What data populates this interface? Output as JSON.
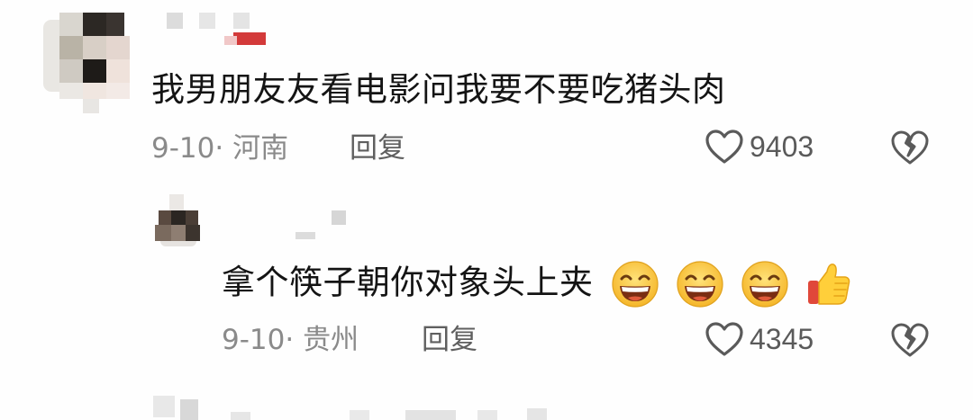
{
  "comments": [
    {
      "text": "我男朋友友看电影问我要不要吃猪头肉",
      "date": "9-10",
      "location": "河南",
      "reply_label": "回复",
      "likes": "9403"
    },
    {
      "text": "拿个筷子朝你对象头上夹",
      "emojis": [
        "grin-emoji",
        "grin-emoji",
        "grin-emoji",
        "thumbs-up-emoji"
      ],
      "date": "9-10",
      "location": "贵州",
      "reply_label": "回复",
      "likes": "4345"
    }
  ],
  "separator": "·",
  "colors": {
    "text": "#141414",
    "meta": "#8a8a8a",
    "icon": "#5a5a5a",
    "emoji_face": "#f8c23a",
    "mosaic_light": "#e6e6e6",
    "mosaic_dark": "#2b2622"
  }
}
